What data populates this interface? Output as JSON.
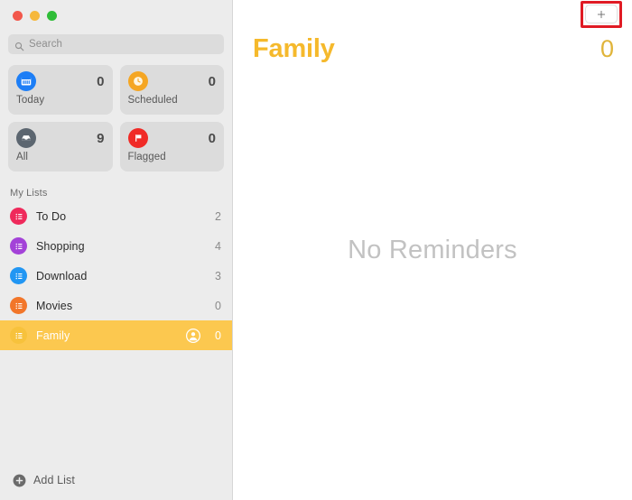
{
  "window": {
    "traffic_lights": [
      {
        "name": "close",
        "color": "#f2574b"
      },
      {
        "name": "minimize",
        "color": "#f6b83c"
      },
      {
        "name": "maximize",
        "color": "#2fbd38"
      }
    ]
  },
  "sidebar": {
    "search": {
      "icon": "search-icon",
      "placeholder": "Search",
      "value": ""
    },
    "smart_lists": [
      {
        "id": "today",
        "label": "Today",
        "count": "0",
        "icon": "calendar-icon",
        "color": "#1d7ef6"
      },
      {
        "id": "scheduled",
        "label": "Scheduled",
        "count": "0",
        "icon": "clock-icon",
        "color": "#f5a623"
      },
      {
        "id": "all",
        "label": "All",
        "count": "9",
        "icon": "inbox-icon",
        "color": "#5c6670"
      },
      {
        "id": "flagged",
        "label": "Flagged",
        "count": "0",
        "icon": "flag-icon",
        "color": "#f02a26"
      }
    ],
    "my_lists_header": "My Lists",
    "lists": [
      {
        "id": "to-do",
        "label": "To Do",
        "count": "2",
        "color": "#ef2a5b",
        "selected": false,
        "shared": false
      },
      {
        "id": "shopping",
        "label": "Shopping",
        "count": "4",
        "color": "#a342d8",
        "selected": false,
        "shared": false
      },
      {
        "id": "download",
        "label": "Download",
        "count": "3",
        "color": "#2196f3",
        "selected": false,
        "shared": false
      },
      {
        "id": "movies",
        "label": "Movies",
        "count": "0",
        "color": "#f2762a",
        "selected": false,
        "shared": false
      },
      {
        "id": "family",
        "label": "Family",
        "count": "0",
        "color": "#f7c23c",
        "selected": true,
        "shared": true
      }
    ],
    "add_list": {
      "label": "Add List",
      "icon": "plus-circle-icon"
    }
  },
  "main": {
    "toolbar": {
      "add_reminder_icon": "plus-icon",
      "annotation_color": "#e01b24"
    },
    "title": "Family",
    "count": "0",
    "title_color": "#f5b92c",
    "empty_message": "No Reminders"
  }
}
